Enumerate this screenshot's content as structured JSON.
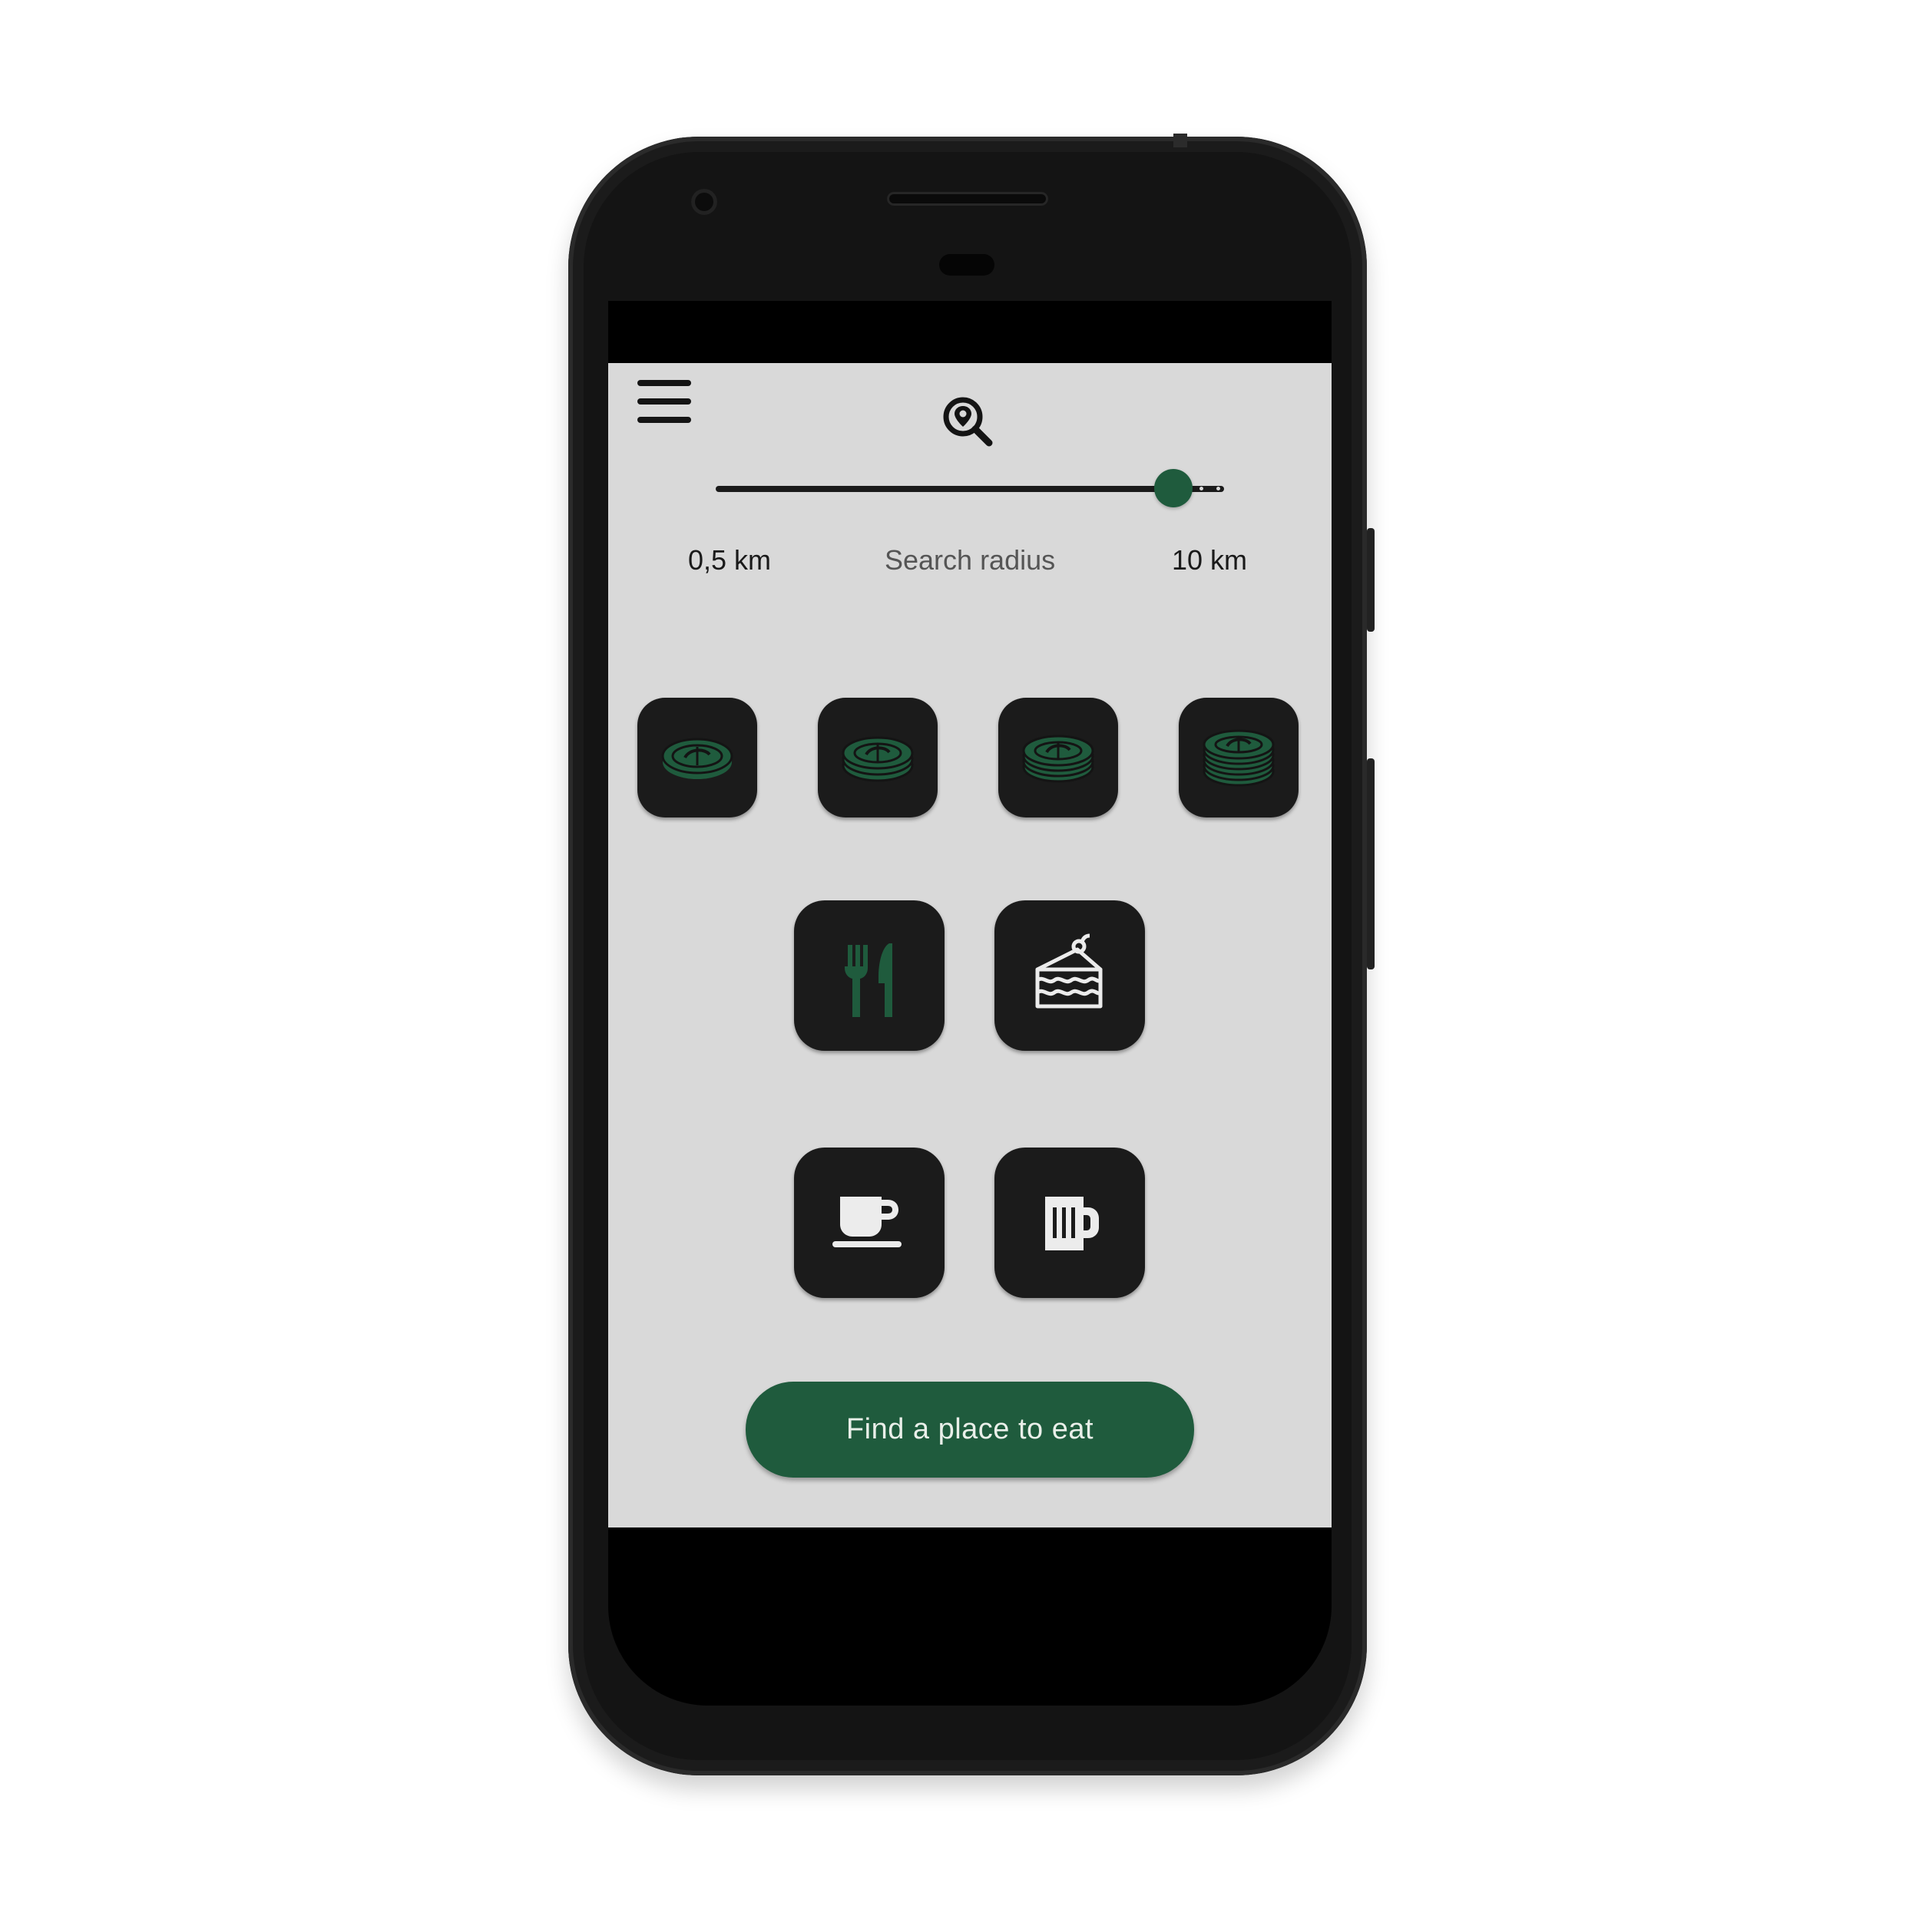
{
  "header": {
    "menu_icon": "hamburger-menu-icon",
    "logo_icon": "location-search-icon"
  },
  "radius": {
    "min_label": "0,5 km",
    "caption": "Search radius",
    "max_label": "10 km",
    "value_fraction": 0.9
  },
  "price_levels": [
    {
      "icon": "coins-1-icon"
    },
    {
      "icon": "coins-2-icon"
    },
    {
      "icon": "coins-3-icon"
    },
    {
      "icon": "coins-4-icon"
    }
  ],
  "categories": [
    {
      "icon": "fork-knife-icon"
    },
    {
      "icon": "cake-icon"
    },
    {
      "icon": "coffee-cup-icon"
    },
    {
      "icon": "beer-mug-icon"
    }
  ],
  "cta": {
    "label": "Find a place to eat"
  },
  "colors": {
    "accent": "#1f5b3d",
    "tile": "#1b1b1b",
    "background": "#d9d9d9"
  }
}
